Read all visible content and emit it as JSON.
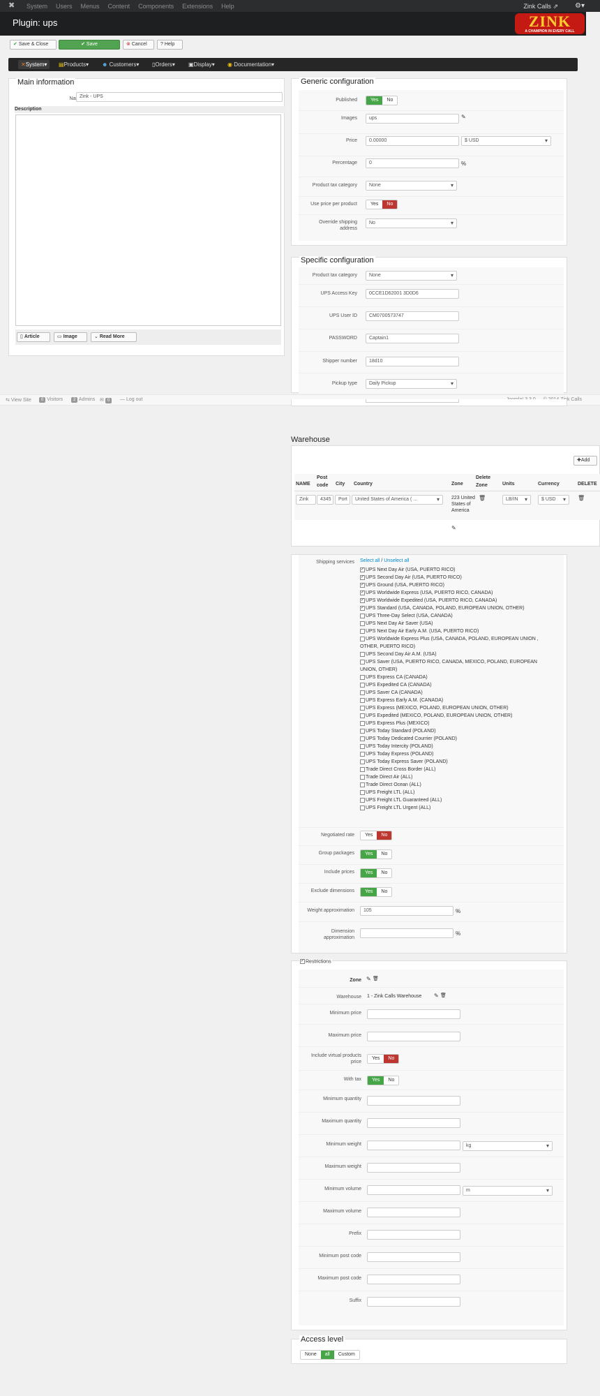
{
  "topbar": {
    "menu": [
      "System",
      "Users",
      "Menus",
      "Content",
      "Components",
      "Extensions",
      "Help"
    ],
    "site": "Zink Calls",
    "gear": "⚙▾"
  },
  "title": "Plugin: ups",
  "logo": {
    "text": "ZINK",
    "tagline": "A CHAMPION IN EVERY CALL"
  },
  "toolbar": {
    "save_close": "Save & Close",
    "save": "Save",
    "cancel": "Cancel",
    "help": "Help"
  },
  "nav": [
    "System",
    "Products",
    "Customers",
    "Orders",
    "Display",
    "Documentation"
  ],
  "main": {
    "title": "Main information",
    "name_label": "Name",
    "name_value": "Zink - UPS",
    "description_label": "Description",
    "editor_buttons": [
      "Article",
      "Image",
      "Read More"
    ]
  },
  "generic": {
    "title": "Generic configuration",
    "published": "Published",
    "images": "Images",
    "images_value": "ups",
    "price": "Price",
    "price_value": "0.00000",
    "currency": "$ USD",
    "percentage": "Percentage",
    "percentage_value": "0",
    "percent": "%",
    "tax": "Product tax category",
    "tax_value": "None",
    "use_price": "Use price per product",
    "override": "Override shipping address",
    "override_value": "No",
    "yes": "Yes",
    "no": "No"
  },
  "specific": {
    "title": "Specific configuration",
    "tax": "Product tax category",
    "tax_value": "None",
    "access_key": "UPS Access Key",
    "access_key_value": "0CCE1D62001 3D0D6",
    "user_id": "UPS User ID",
    "user_id_value": "CM0700573747",
    "password": "PASSWORD",
    "password_value": "Captain1",
    "shipper": "Shipper number",
    "shipper_value": "18d10",
    "pickup": "Pickup type",
    "pickup_value": "Daily Pickup"
  },
  "footer": {
    "view_site": "View Site",
    "visitors_count": "0",
    "visitors": "Visitors",
    "admins_count": "2",
    "admins": "Admins",
    "messages_count": "0",
    "logout": "Log out",
    "copyright": "Joomla! 3.3.0 — © 2014 Zink Calls"
  },
  "warehouse": {
    "title": "Warehouse",
    "add": "Add",
    "headers": [
      "NAME",
      "Post code",
      "City",
      "Country",
      "Zone",
      "Delete Zone",
      "Units",
      "Currency",
      "DELETE"
    ],
    "row": {
      "name": "Zink",
      "post": "4345",
      "city": "Port",
      "country": "United States of America ( ...",
      "zone": "223 United States of America",
      "units": "LB/IN",
      "currency": "$ USD"
    }
  },
  "services": {
    "label": "Shipping services",
    "select_all": "Select all",
    "sep": " / ",
    "unselect_all": "Unselect all",
    "items": [
      {
        "t": "UPS Next Day Air (USA, PUERTO RICO)",
        "c": true
      },
      {
        "t": "UPS Second Day Air (USA, PUERTO RICO)",
        "c": true
      },
      {
        "t": "UPS Ground (USA, PUERTO RICO)",
        "c": true
      },
      {
        "t": "UPS Worldwide Express (USA, PUERTO RICO, CANADA)",
        "c": true
      },
      {
        "t": "UPS Worldwide Expedited (USA, PUERTO RICO, CANADA)",
        "c": true
      },
      {
        "t": "UPS Standard (USA, CANADA, POLAND, EUROPEAN UNION, OTHER)",
        "c": true
      },
      {
        "t": "UPS Three-Day Select (USA, CANADA)",
        "c": false
      },
      {
        "t": "UPS Next Day Air Saver (USA)",
        "c": false
      },
      {
        "t": "UPS Next Day Air Early A.M. (USA, PUERTO RICO)",
        "c": false
      },
      {
        "t": "UPS Worldwide Express Plus (USA, CANADA, POLAND, EUROPEAN UNION ,",
        "t2": "OTHER, PUERTO RICO)",
        "c": false
      },
      {
        "t": "UPS Second Day Air A.M. (USA)",
        "c": false
      },
      {
        "t": "UPS Saver (USA, PUERTO RICO, CANADA, MEXICO, POLAND, EUROPEAN",
        "t2": "UNION, OTHER)",
        "c": false
      },
      {
        "t": "UPS Express CA (CANADA)",
        "c": false
      },
      {
        "t": "UPS Expedited CA (CANADA)",
        "c": false
      },
      {
        "t": "UPS Saver CA (CANADA)",
        "c": false
      },
      {
        "t": "UPS Express Early A.M. (CANADA)",
        "c": false
      },
      {
        "t": "UPS Express (MEXICO, POLAND, EUROPEAN UNION, OTHER)",
        "c": false
      },
      {
        "t": "UPS Expedited (MEXICO, POLAND, EUROPEAN UNION, OTHER)",
        "c": false
      },
      {
        "t": "UPS Express Plus (MEXICO)",
        "c": false
      },
      {
        "t": "UPS Today Standard (POLAND)",
        "c": false
      },
      {
        "t": "UPS Today Dedicated Courrier (POLAND)",
        "c": false
      },
      {
        "t": "UPS Today Intercity (POLAND)",
        "c": false
      },
      {
        "t": "UPS Today Express (POLAND)",
        "c": false
      },
      {
        "t": "UPS Today Express Saver (POLAND)",
        "c": false
      },
      {
        "t": "Trade Direct Cross Border (ALL)",
        "c": false
      },
      {
        "t": "Trade Direct Air (ALL)",
        "c": false
      },
      {
        "t": "Trade Direct Ocean (ALL)",
        "c": false
      },
      {
        "t": "UPS Freight LTL (ALL)",
        "c": false
      },
      {
        "t": "UPS Freight LTL Guaranteed (ALL)",
        "c": false
      },
      {
        "t": "UPS Freight LTL Urgent (ALL)",
        "c": false
      }
    ]
  },
  "options": {
    "negotiated": "Negotiated rate",
    "group": "Group packages",
    "include_prices": "Include prices",
    "exclude_dims": "Exclude dimensions",
    "weight_approx": "Weight approximation",
    "weight_approx_value": "105",
    "dim_approx": "Dimension approximation",
    "percent": "%"
  },
  "restrictions": {
    "title": "Restrictions",
    "zone": "Zone",
    "warehouse": "Warehouse",
    "warehouse_value": "1 - Zink Calls Warehouse",
    "min_price": "Minimum price",
    "max_price": "Maximum price",
    "virtual": "Include virtual products price",
    "with_tax": "With tax",
    "min_qty": "Minimum quantity",
    "max_qty": "Maximum quantity",
    "min_weight": "Minimum weight",
    "weight_unit": "kg",
    "max_weight": "Maximum weight",
    "min_volume": "Minimum volume",
    "volume_unit": "m",
    "max_volume": "Maximum volume",
    "prefix": "Prefix",
    "min_post": "Minimum post code",
    "max_post": "Maximum post code",
    "suffix": "Suffix"
  },
  "access": {
    "title": "Access level",
    "none": "None",
    "all": "all",
    "custom": "Custom"
  }
}
